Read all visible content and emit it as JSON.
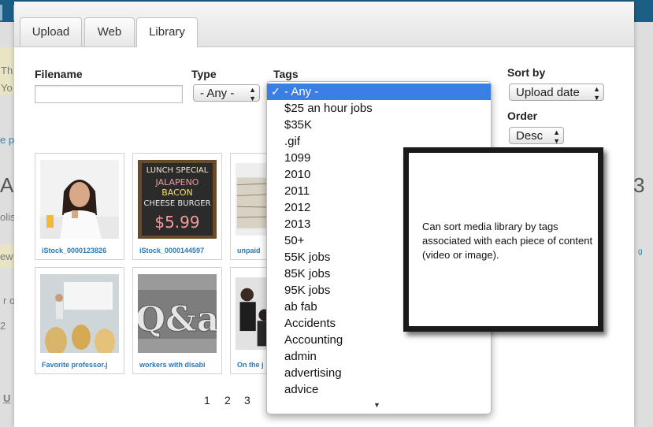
{
  "tabs": [
    {
      "label": "Upload"
    },
    {
      "label": "Web"
    },
    {
      "label": "Library",
      "active": true
    }
  ],
  "filters": {
    "filename_label": "Filename",
    "filename_value": "",
    "type_label": "Type",
    "type_value": "- Any -",
    "tags_label": "Tags",
    "sortby_label": "Sort by",
    "sortby_value": "Upload date",
    "order_label": "Order",
    "order_value": "Desc"
  },
  "tags_dropdown": {
    "selected": "- Any -",
    "items": [
      "- Any -",
      "$25 an hour jobs",
      "$35K",
      ".gif",
      "1099",
      "2010",
      "2011",
      "2012",
      "2013",
      "50+",
      "55K jobs",
      "85K jobs",
      "95K jobs",
      "ab fab",
      "Accidents",
      "Accounting",
      "admin",
      "advertising",
      "advice"
    ]
  },
  "thumbnails": [
    {
      "caption": "iStock_0000123826",
      "icon": "woman-at-desk-image"
    },
    {
      "caption": "iStock_0000144597",
      "icon": "lunch-special-chalkboard-image"
    },
    {
      "caption": "unpaid",
      "icon": "paper-stacks-image"
    },
    {
      "caption": "Favorite professor.j",
      "icon": "lecture-hall-image"
    },
    {
      "caption": "workers with disabi",
      "icon": "qa-letterpress-image"
    },
    {
      "caption": "On the j",
      "icon": "office-workers-image"
    }
  ],
  "pager": {
    "pages": [
      "1",
      "2",
      "3"
    ]
  },
  "callout": {
    "text": "Can sort media library by tags associated with each piece of content (video or image)."
  },
  "background_fragments": {
    "f1": "Th",
    "f2": "Yo",
    "f3": "e p",
    "f4": "A",
    "f5": "olis",
    "f6": "ew",
    "f7": "r o",
    "f8": "2",
    "f9": "U",
    "f10": "3",
    "f11": "g"
  },
  "colors": {
    "accent": "#3a7ee6",
    "link": "#2a78b6",
    "topbar": "#1b5f86"
  }
}
